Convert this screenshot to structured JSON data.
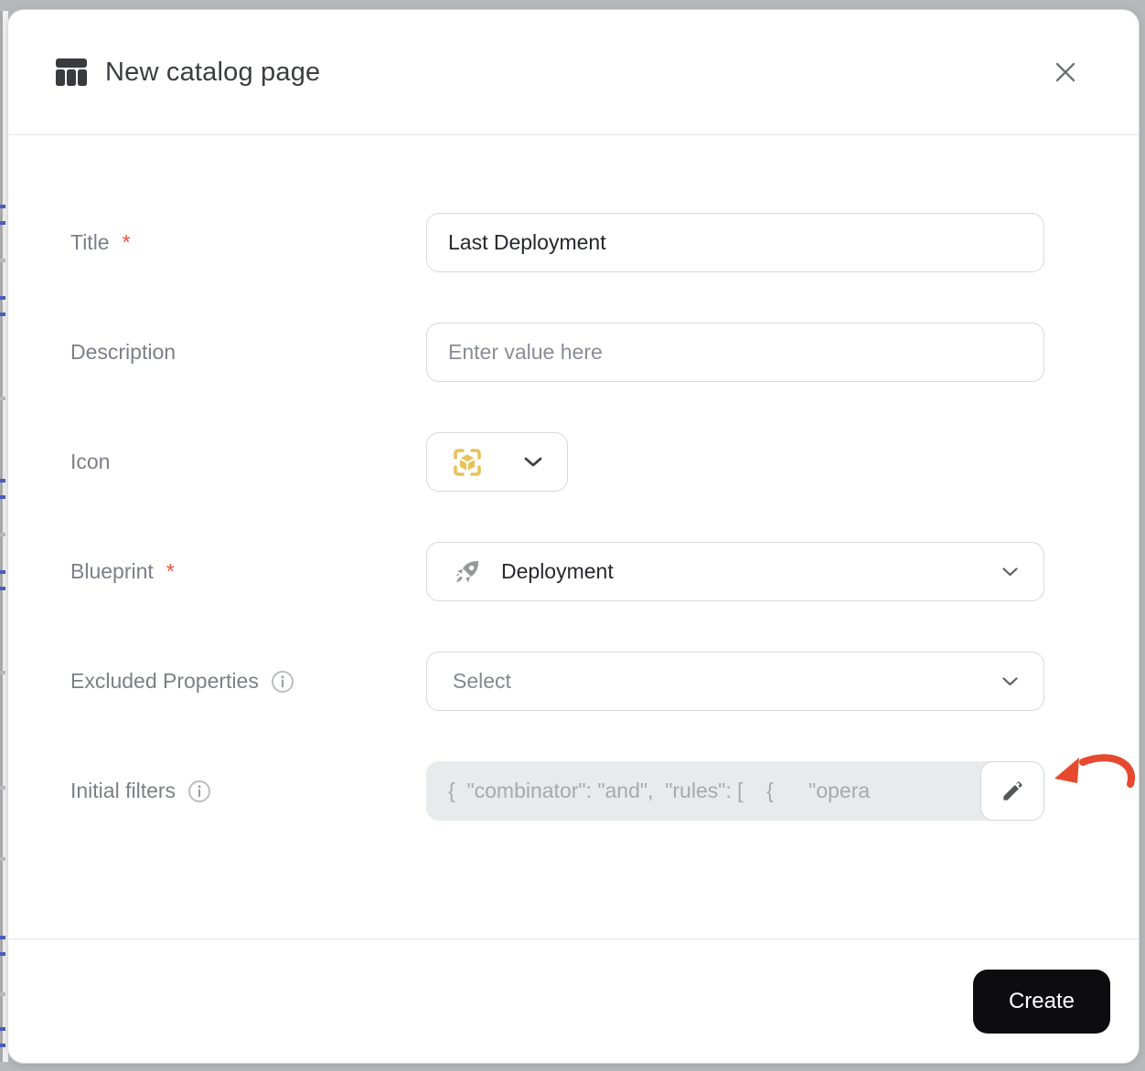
{
  "dialog": {
    "title": "New catalog page",
    "title_icon": "table-columns",
    "close_icon": "x"
  },
  "form": {
    "title": {
      "label": "Title",
      "required_marker": "*",
      "value": "Last Deployment"
    },
    "description": {
      "label": "Description",
      "placeholder": "Enter value here"
    },
    "icon": {
      "label": "Icon",
      "selected_icon": "blueprint-cube",
      "chevron_icon": "chevron-down"
    },
    "blueprint": {
      "label": "Blueprint",
      "required_marker": "*",
      "value": "Deployment",
      "value_icon": "rocket",
      "chevron_icon": "chevron-down"
    },
    "excluded_properties": {
      "label": "Excluded Properties",
      "info_icon": "info-circle",
      "placeholder": "Select",
      "chevron_icon": "chevron-down"
    },
    "initial_filters": {
      "label": "Initial filters",
      "info_icon": "info-circle",
      "value": "{  \"combinator\": \"and\",  \"rules\": [    {      \"opera",
      "edit_icon": "pencil",
      "annotation_icon": "curved-red-arrow"
    }
  },
  "footer": {
    "create_label": "Create"
  },
  "colors": {
    "accent_yellow": "#e7c25c",
    "required_red": "#e8543c",
    "arrow_red": "#e6492e",
    "create_button": "#0d0d0f",
    "label_gray": "#7c7f85",
    "disabled_bg": "#e9eaeb"
  }
}
